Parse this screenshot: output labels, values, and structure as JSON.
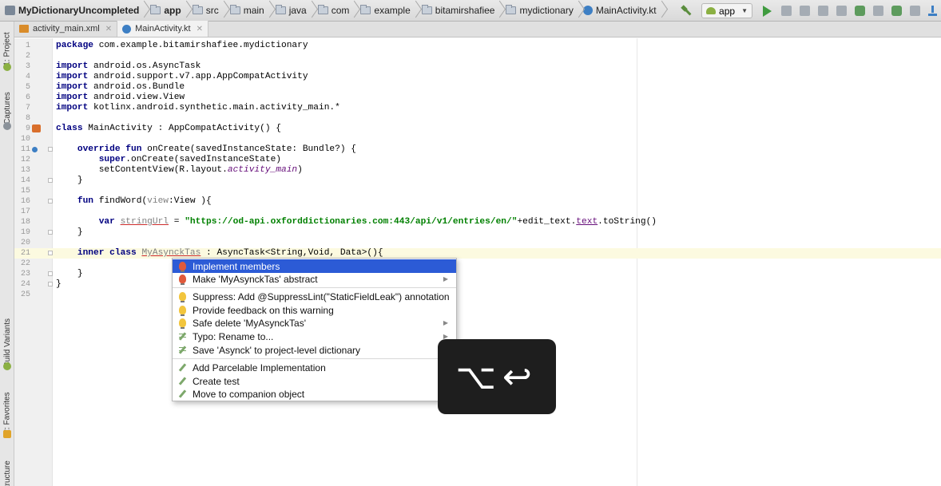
{
  "navbar": {
    "crumbs": [
      "MyDictionaryUncompleted",
      "app",
      "src",
      "main",
      "java",
      "com",
      "example",
      "bitamirshafiee",
      "mydictionary",
      "MainActivity.kt"
    ],
    "run_config": "app"
  },
  "tabs": [
    {
      "label": "activity_main.xml",
      "active": false
    },
    {
      "label": "MainActivity.kt",
      "active": true
    }
  ],
  "left_strip": {
    "project": "1: Project",
    "captures": "Captures",
    "build_variants": "Build Variants",
    "favorites": "2: Favorites",
    "structure": "Structure"
  },
  "code": {
    "l1": {
      "kw": "package",
      "rest": " com.example.bitamirshafiee.mydictionary"
    },
    "l3": {
      "kw": "import",
      "rest": " android.os.AsyncTask"
    },
    "l4": {
      "kw": "import",
      "rest": " android.support.v7.app.AppCompatActivity"
    },
    "l5": {
      "kw": "import",
      "rest": " android.os.Bundle"
    },
    "l6": {
      "kw": "import",
      "rest": " android.view.View"
    },
    "l7": {
      "kw": "import",
      "rest": " kotlinx.android.synthetic.main.activity_main.*"
    },
    "l9": {
      "kw": "class",
      "rest": " MainActivity : AppCompatActivity() {"
    },
    "l11": {
      "kw": "override fun",
      "rest": " onCreate(savedInstanceState: Bundle?) {"
    },
    "l12": {
      "kw": "super",
      "rest": ".onCreate(savedInstanceState)"
    },
    "l13": {
      "pre": "setContentView(R.layout.",
      "it": "activity_main",
      "post": ")"
    },
    "l14": "}",
    "l16": {
      "kw": "fun",
      "pre": " findWord(",
      "param": "view",
      "post": ":View ){"
    },
    "l18": {
      "kw": "var",
      "var": "stringUrl",
      "eq": " = ",
      "str": "\"https://od-api.oxforddictionaries.com:443/api/v1/entries/en/\"",
      "mid": "+edit_text.",
      "prop": "text",
      "post": ".toString()"
    },
    "l19": "}",
    "l21": {
      "kw": "inner class",
      "name": "MyAsynckTas",
      "post": " : AsyncTask<String,Void, Data>(){"
    },
    "l23": "}",
    "l24": "}"
  },
  "popup": {
    "items": [
      {
        "label": "Implement members",
        "selected": true
      },
      {
        "label": "Make 'MyAsynckTas' abstract"
      },
      {
        "label": "Suppress: Add @SuppressLint(\"StaticFieldLeak\") annotation"
      },
      {
        "label": "Provide feedback on this warning"
      },
      {
        "label": "Safe delete 'MyAsynckTas'"
      },
      {
        "label": "Typo: Rename to..."
      },
      {
        "label": "Save 'Asynck' to project-level dictionary"
      },
      {
        "label": "Add Parcelable Implementation"
      },
      {
        "label": "Create test"
      },
      {
        "label": "Move to companion object"
      }
    ]
  },
  "keycast": "⌥↩"
}
